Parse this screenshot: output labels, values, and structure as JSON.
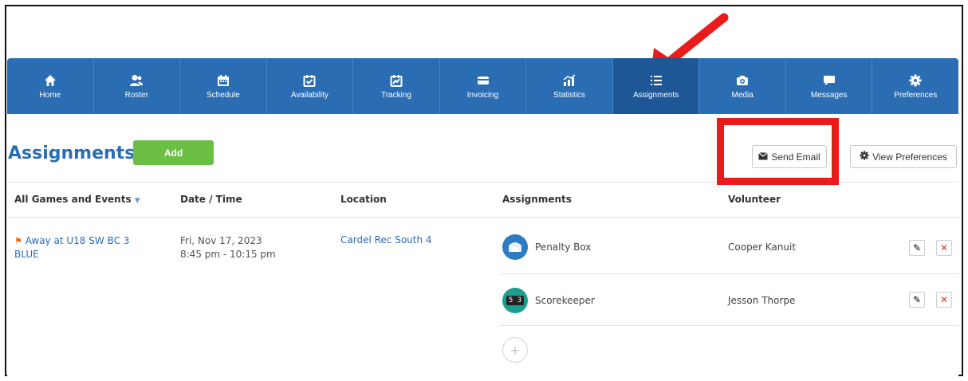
{
  "nav": {
    "items": [
      {
        "label": "Home",
        "icon": "home-icon"
      },
      {
        "label": "Roster",
        "icon": "users-icon"
      },
      {
        "label": "Schedule",
        "icon": "calendar-icon"
      },
      {
        "label": "Availability",
        "icon": "check-calendar-icon"
      },
      {
        "label": "Tracking",
        "icon": "tracking-icon"
      },
      {
        "label": "Invoicing",
        "icon": "card-icon"
      },
      {
        "label": "Statistics",
        "icon": "stats-icon"
      },
      {
        "label": "Assignments",
        "icon": "list-icon"
      },
      {
        "label": "Media",
        "icon": "camera-icon"
      },
      {
        "label": "Messages",
        "icon": "chat-icon"
      },
      {
        "label": "Preferences",
        "icon": "gear-icon"
      }
    ],
    "active_index": 7
  },
  "page": {
    "title": "Assignments",
    "add_label": "Add",
    "send_email_label": "Send Email",
    "view_prefs_label": "View Preferences"
  },
  "table": {
    "headers": {
      "event": "All Games and Events",
      "datetime": "Date / Time",
      "location": "Location",
      "assignments": "Assignments",
      "volunteer": "Volunteer"
    },
    "event": {
      "title": "Away at U18 SW BC 3 BLUE",
      "date": "Fri, Nov 17, 2023",
      "time": "8:45 pm - 10:15 pm",
      "location": "Cardel Rec South 4"
    },
    "assignments": [
      {
        "role": "Penalty Box",
        "volunteer": "Cooper Kanuit",
        "icon": "penalty-box-icon"
      },
      {
        "role": "Scorekeeper",
        "volunteer": "Jesson Thorpe",
        "icon": "scoreboard-icon",
        "icon_text": "5 3"
      }
    ]
  },
  "colors": {
    "nav": "#2a6db3",
    "nav_active": "#1d5796",
    "add": "#6cbf45",
    "highlight": "#ea1b1b"
  }
}
